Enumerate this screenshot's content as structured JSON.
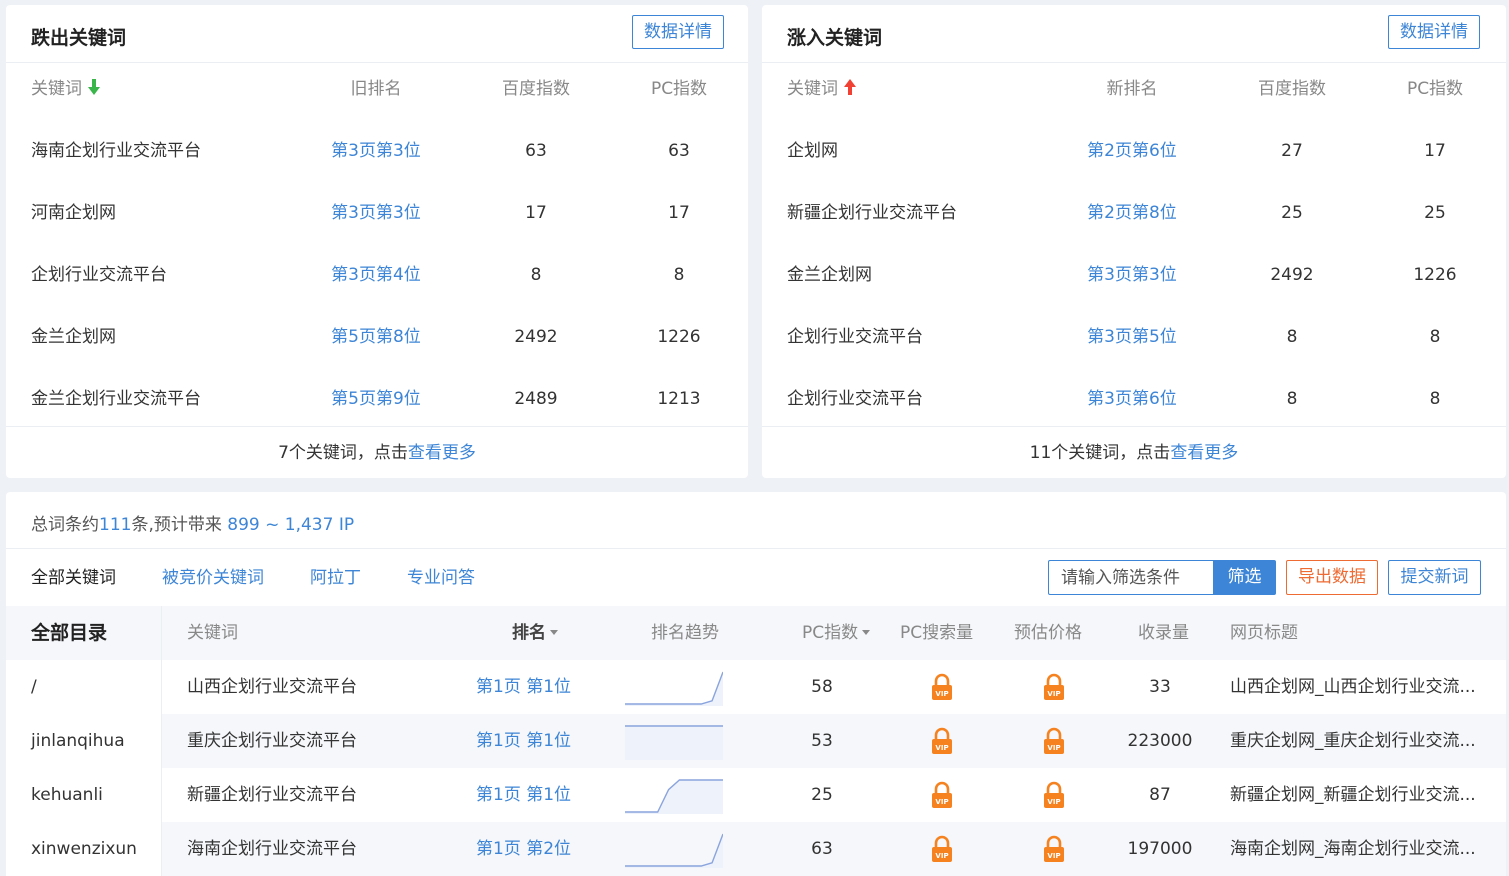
{
  "left_panel": {
    "title": "跌出关键词",
    "detail_button": "数据详情",
    "headers": {
      "keyword": "关键词",
      "rank": "旧排名",
      "baidu_index": "百度指数",
      "pc_index": "PC指数"
    },
    "arrow_color": "#3ab54a",
    "rows": [
      {
        "keyword": "海南企划行业交流平台",
        "rank": "第3页第3位",
        "baidu": "63",
        "pc": "63"
      },
      {
        "keyword": "河南企划网",
        "rank": "第3页第3位",
        "baidu": "17",
        "pc": "17"
      },
      {
        "keyword": "企划行业交流平台",
        "rank": "第3页第4位",
        "baidu": "8",
        "pc": "8"
      },
      {
        "keyword": "金兰企划网",
        "rank": "第5页第8位",
        "baidu": "2492",
        "pc": "1226"
      },
      {
        "keyword": "金兰企划行业交流平台",
        "rank": "第5页第9位",
        "baidu": "2489",
        "pc": "1213"
      }
    ],
    "footer_prefix": "7个关键词，点击",
    "footer_link": "查看更多"
  },
  "right_panel": {
    "title": "涨入关键词",
    "detail_button": "数据详情",
    "headers": {
      "keyword": "关键词",
      "rank": "新排名",
      "baidu_index": "百度指数",
      "pc_index": "PC指数"
    },
    "arrow_color": "#f04134",
    "rows": [
      {
        "keyword": "企划网",
        "rank": "第2页第6位",
        "baidu": "27",
        "pc": "17"
      },
      {
        "keyword": "新疆企划行业交流平台",
        "rank": "第2页第8位",
        "baidu": "25",
        "pc": "25"
      },
      {
        "keyword": "金兰企划网",
        "rank": "第3页第3位",
        "baidu": "2492",
        "pc": "1226"
      },
      {
        "keyword": "企划行业交流平台",
        "rank": "第3页第5位",
        "baidu": "8",
        "pc": "8"
      },
      {
        "keyword": "企划行业交流平台",
        "rank": "第3页第6位",
        "baidu": "8",
        "pc": "8"
      }
    ],
    "footer_prefix": "11个关键词，点击",
    "footer_link": "查看更多"
  },
  "bottom": {
    "summary": {
      "prefix": "总词条约",
      "count": "111",
      "mid": "条,预计带来",
      "range": " 899 ~ 1,437 IP"
    },
    "tabs": [
      "全部关键词",
      "被竞价关键词",
      "阿拉丁",
      "专业问答"
    ],
    "filter_placeholder": "请输入筛选条件",
    "filter_button": "筛选",
    "export_button": "导出数据",
    "submit_button": "提交新词",
    "directory": {
      "title": "全部目录",
      "items": [
        "/",
        "jinlanqihua",
        "kehuanli",
        "xinwenzixun"
      ]
    },
    "columns": [
      "关键词",
      "排名",
      "排名趋势",
      "PC指数",
      "PC搜索量",
      "预估价格",
      "收录量",
      "网页标题"
    ],
    "rows": [
      {
        "keyword": "山西企划行业交流平台",
        "rank": "第1页 第1位",
        "pc_index": "58",
        "indexed": "33",
        "page_title": "山西企划网_山西企划行业交流...",
        "trend": [
          1,
          1,
          1,
          1,
          1,
          1,
          1,
          1,
          0.9,
          0
        ]
      },
      {
        "keyword": "重庆企划行业交流平台",
        "rank": "第1页 第1位",
        "pc_index": "53",
        "indexed": "223000",
        "page_title": "重庆企划网_重庆企划行业交流...",
        "trend": [
          0,
          0,
          0,
          0,
          0,
          0,
          0,
          0,
          0,
          0
        ]
      },
      {
        "keyword": "新疆企划行业交流平台",
        "rank": "第1页 第1位",
        "pc_index": "25",
        "indexed": "87",
        "page_title": "新疆企划网_新疆企划行业交流...",
        "trend": [
          1,
          1,
          1,
          1,
          0.3,
          0,
          0,
          0,
          0,
          0
        ]
      },
      {
        "keyword": "海南企划行业交流平台",
        "rank": "第1页 第2位",
        "pc_index": "63",
        "indexed": "197000",
        "page_title": "海南企划网_海南企划行业交流...",
        "trend": [
          1,
          1,
          1,
          1,
          1,
          1,
          1,
          1,
          0.9,
          0
        ]
      }
    ],
    "lock_color": "#f5821f",
    "vip_label": "VIP"
  }
}
